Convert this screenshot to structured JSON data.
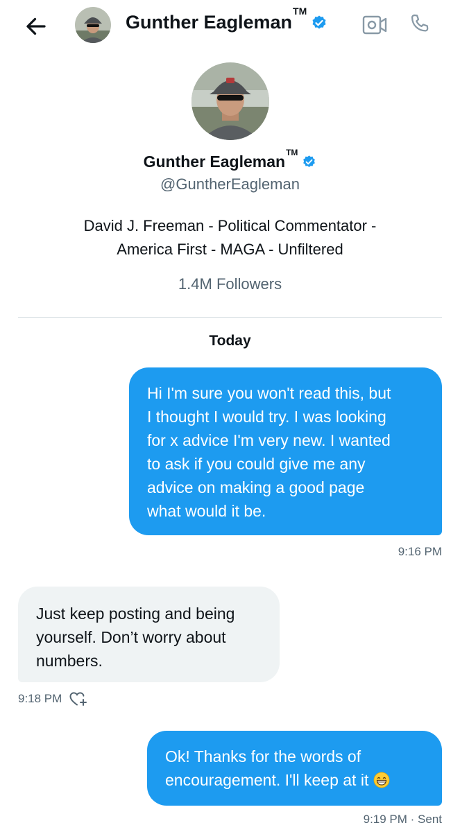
{
  "header": {
    "name": "Gunther Eagleman",
    "tm": "TM"
  },
  "profile": {
    "name": "Gunther Eagleman",
    "tm": "TM",
    "handle": "@GuntherEagleman",
    "bio_line1": "David J. Freeman - Political Commentator -",
    "bio_line2": "America First - MAGA - Unfiltered",
    "followers": "1.4M Followers"
  },
  "conversation": {
    "date_label": "Today",
    "messages": [
      {
        "direction": "outgoing",
        "lines": [
          "Hi I'm sure you won't read this, but",
          "I thought I would try. I was looking",
          "for x advice I'm very new. I wanted",
          "to ask if you could give me any",
          "advice on making a good page",
          "what would it be."
        ],
        "time": "9:16 PM"
      },
      {
        "direction": "incoming",
        "lines": [
          "Just keep posting and being",
          "yourself.  Don’t worry about",
          "numbers."
        ],
        "time": "9:18 PM"
      },
      {
        "direction": "outgoing",
        "lines": [
          "Ok! Thanks for the words of",
          "encouragement. I'll keep at it"
        ],
        "emoji": "grinning-face-with-smiling-eyes",
        "time": "9:19 PM · Sent"
      }
    ]
  },
  "colors": {
    "accent": "#1d9bf0",
    "incoming_bubble": "#eff3f4",
    "secondary_text": "#536471"
  }
}
